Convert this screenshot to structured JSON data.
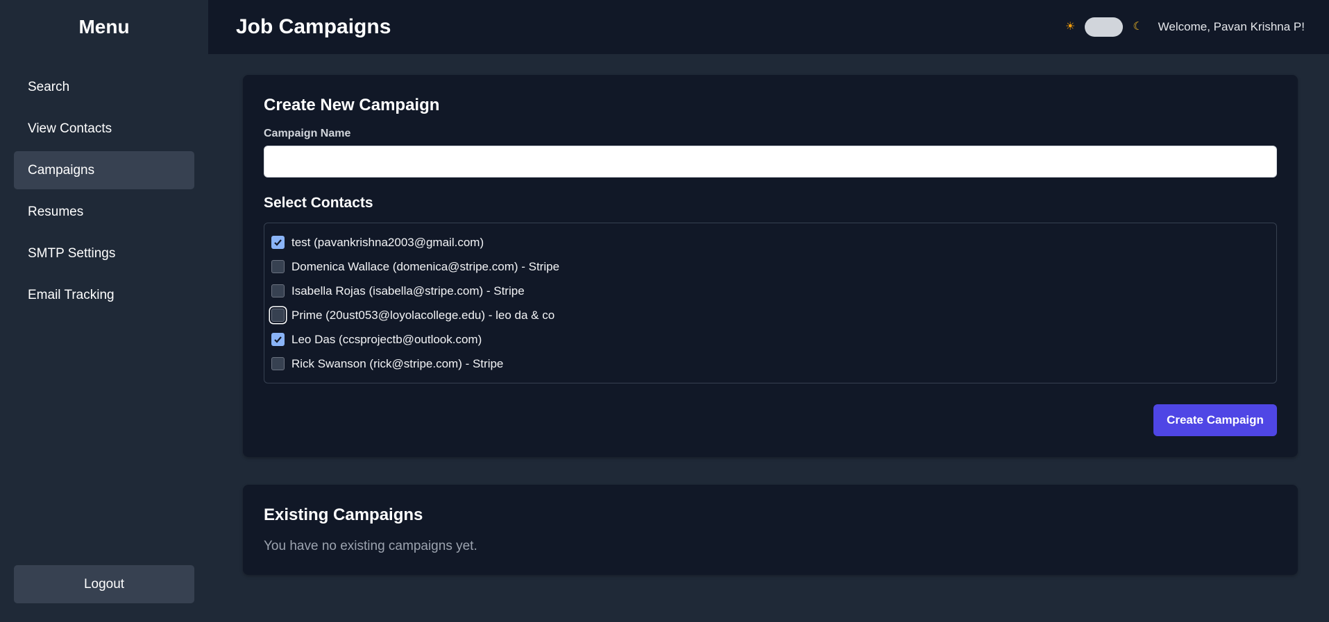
{
  "sidebar": {
    "title": "Menu",
    "items": [
      {
        "label": "Search"
      },
      {
        "label": "View Contacts"
      },
      {
        "label": "Campaigns",
        "active": true
      },
      {
        "label": "Resumes"
      },
      {
        "label": "SMTP Settings"
      },
      {
        "label": "Email Tracking"
      }
    ],
    "logout_label": "Logout"
  },
  "header": {
    "title": "Job Campaigns",
    "sun_icon": "☀",
    "moon_icon": "☾",
    "theme_toggle": "light-dark",
    "welcome": "Welcome, Pavan Krishna P!"
  },
  "create_campaign": {
    "heading": "Create New Campaign",
    "name_label": "Campaign Name",
    "name_value": "",
    "contacts_heading": "Select Contacts",
    "contacts": [
      {
        "label": "test (pavankrishna2003@gmail.com)",
        "checked": true
      },
      {
        "label": "Domenica Wallace (domenica@stripe.com) - Stripe",
        "checked": false
      },
      {
        "label": "Isabella Rojas (isabella@stripe.com) - Stripe",
        "checked": false
      },
      {
        "label": "Prime (20ust053@loyolacollege.edu) - leo da & co",
        "checked": false,
        "focused": true
      },
      {
        "label": "Leo Das (ccsprojectb@outlook.com)",
        "checked": true
      },
      {
        "label": "Rick Swanson (rick@stripe.com) - Stripe",
        "checked": false
      }
    ],
    "submit_label": "Create Campaign"
  },
  "existing_campaigns": {
    "heading": "Existing Campaigns",
    "empty_message": "You have no existing campaigns yet."
  },
  "colors": {
    "sidebar_bg": "#1f2937",
    "panel_bg": "#111827",
    "accent": "#4f46e5",
    "checkbox_checked": "#8ab4f8"
  }
}
